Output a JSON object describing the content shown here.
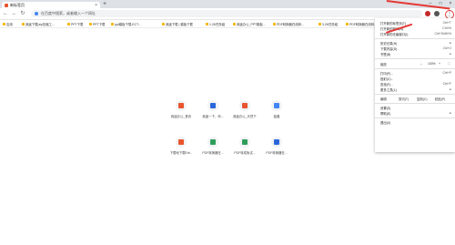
{
  "tab": {
    "title": "新标签页",
    "close": "×"
  },
  "newtab": "+",
  "window": {
    "min": "–",
    "max": "□",
    "close": "×"
  },
  "nav": {
    "back": "←",
    "forward": "→",
    "reload": "↻"
  },
  "omnibox": {
    "placeholder": "在百度中搜索，或者输入一个网址"
  },
  "bookmarks": [
    "应用",
    "我迷下载|zip压缩工...",
    "PPT下载",
    "PPT下载",
    "ppt模板下载-ECT...",
    "我迷下载 | 模板下载",
    "1.2K任务组",
    "我迷办公_PPT模板...",
    "PDF转换器在线转...",
    "3.2K任务组",
    "PDF转换器在线转..."
  ],
  "tiles": [
    {
      "label": "我迷办公_首页",
      "color": "#e8552f"
    },
    {
      "label": "我迷一下，你...",
      "color": "#2b66d9"
    },
    {
      "label": "我迷办公_天然下...",
      "color": "#e8552f"
    },
    {
      "label": "蓝奏",
      "color": "#4285f4"
    },
    {
      "label": "下载地下载Ent...",
      "color": "#e8552f"
    },
    {
      "label": "PDF转换器在...",
      "color": "#2e9e5b"
    },
    {
      "label": "PDF转成免试...",
      "color": "#2e9e5b"
    },
    {
      "label": "PDF转换器在...",
      "color": "#2b66d9"
    }
  ],
  "menu": {
    "items_top": [
      {
        "label": "打开新的标签页(T)",
        "shortcut": "Ctrl+T"
      },
      {
        "label": "打开新的窗口(N)",
        "shortcut": "Ctrl+N"
      },
      {
        "label": "打开新的无痕窗口(I)",
        "shortcut": "Ctrl+Shift+N"
      }
    ],
    "items_mid": [
      {
        "label": "历史记录(H)",
        "shortcut": "▸"
      },
      {
        "label": "下载内容(D)",
        "shortcut": "Ctrl+J"
      },
      {
        "label": "书签(B)",
        "shortcut": "▸"
      }
    ],
    "zoom": {
      "label": "缩放",
      "minus": "–",
      "value": "100%",
      "plus": "+",
      "full": "⛶"
    },
    "items_print": [
      {
        "label": "打印(P)...",
        "shortcut": "Ctrl+P"
      },
      {
        "label": "投射(C)...",
        "shortcut": ""
      },
      {
        "label": "查找(F)...",
        "shortcut": "Ctrl+F"
      },
      {
        "label": "更多工具(L)",
        "shortcut": "▸"
      }
    ],
    "edit": {
      "label": "编辑",
      "cut": "剪切(T)",
      "copy": "复制(C)",
      "paste": "粘贴(P)"
    },
    "items_bottom": [
      {
        "label": "设置(S)",
        "shortcut": ""
      },
      {
        "label": "帮助(E)",
        "shortcut": "▸"
      }
    ],
    "exit": {
      "label": "退出(X)"
    }
  },
  "colors": {
    "accent": "#e53935",
    "tabstrip": "#dee1e6"
  }
}
